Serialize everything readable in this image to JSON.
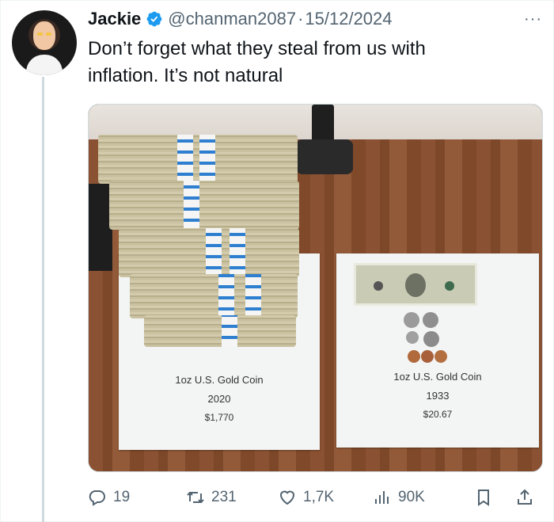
{
  "author": {
    "name": "Jackie",
    "handle": "@chanman2087",
    "separator": "·",
    "date": "15/12/2024"
  },
  "tweet": {
    "line1": "Don’t forget what they steal from us with",
    "line2": "inflation.  It’s not natural"
  },
  "media": {
    "left_card": {
      "title": "1oz U.S. Gold Coin",
      "year": "2020",
      "price": "$1,770"
    },
    "right_card": {
      "title": "1oz U.S. Gold Coin",
      "year": "1933",
      "price": "$20.67"
    }
  },
  "actions": {
    "replies": "19",
    "reposts": "231",
    "likes": "1,7K",
    "views": "90K"
  },
  "colors": {
    "verified": "#1d9bf0",
    "icon": "#536471",
    "text": "#0f1419"
  },
  "icons": [
    "verified-badge-icon",
    "more-icon",
    "reply-icon",
    "repost-icon",
    "like-icon",
    "views-icon",
    "bookmark-icon",
    "share-icon"
  ]
}
